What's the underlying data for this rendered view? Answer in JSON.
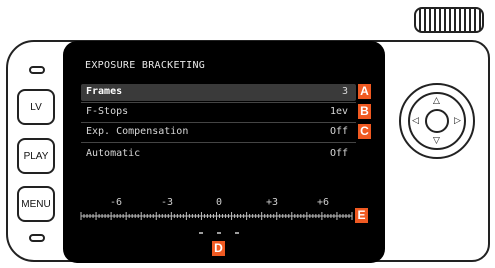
{
  "screen": {
    "title": "EXPOSURE BRACKETING",
    "menu": [
      {
        "label": "Frames",
        "value": "3",
        "marker": "A"
      },
      {
        "label": "F-Stops",
        "value": "1ev",
        "marker": "B"
      },
      {
        "label": "Exp. Compensation",
        "value": "Off",
        "marker": "C"
      },
      {
        "label": "Automatic",
        "value": "Off",
        "marker": ""
      }
    ],
    "scale": {
      "labels": [
        "-6",
        "-3",
        "0",
        "+3",
        "+6"
      ],
      "marker": "E",
      "pointer_marker": "D"
    }
  },
  "buttons": {
    "lv": "LV",
    "play": "PLAY",
    "menu": "MENU"
  }
}
